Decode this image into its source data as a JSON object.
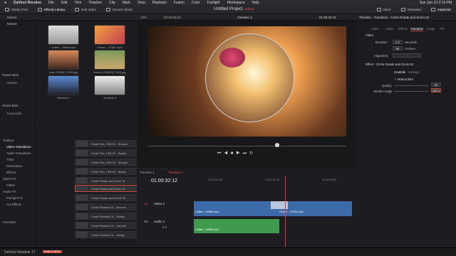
{
  "mac": {
    "app": "DaVinci Resolve",
    "menus": [
      "File",
      "Edit",
      "Trim",
      "Timeline",
      "Clip",
      "Mark",
      "View",
      "Playback",
      "Fusion",
      "Color",
      "Fairlight",
      "Workspace",
      "Help"
    ],
    "datetime": "Sun Jan 10  2:19 PM"
  },
  "toolbar": {
    "media_pool": "Media Pool",
    "effects_library": "Effects Library",
    "edit_index": "Edit Index",
    "sound_library": "Sound Library",
    "project_title": "Untitled Project",
    "edited": "Edited",
    "mixer": "Mixer",
    "metadata": "Metadata",
    "inspector": "Inspector"
  },
  "subbar": {
    "master": "Master",
    "zoom": "43%",
    "timecode_left": "00:00:59:04",
    "timeline_name": "Timeline 2",
    "timecode_right": "01:00:32:12",
    "inspector_title": "Timeline - Transition - Circle Rotate and Zoom 02"
  },
  "media": {
    "items": [
      "Coffee - 40689.mp4",
      "Flower - 37351.mp4",
      "man-721832_1920.jpg",
      "tennis-2785305_1920.jpg",
      "Timeline 1",
      "Timeline 2"
    ]
  },
  "bins": {
    "power": "Power Bins",
    "power_master": "Master",
    "smart": "Smart Bins",
    "keywords": "Keywords"
  },
  "fxtree": {
    "toolbox": "Toolbox",
    "video_transitions": "Video Transitions",
    "audio_transitions": "Audio Transitions",
    "titles": "Titles",
    "generators": "Generators",
    "effects": "Effects",
    "open_fx": "Open FX",
    "filters": "Filters",
    "audio_fx": "Audio FX",
    "fairlight_fx": "Fairlight FX",
    "au_effects": "AU Effects",
    "favorites": "Favorites"
  },
  "fxlist": [
    "Circle Pan_T&B 02 - Bounce",
    "Circle Pan_T&B 02 - Elastic",
    "Circle Pan_T&B 02 - Smooth",
    "Circle Pan_T&B 02 - Swing",
    "Circle Rotate and Zoom 01",
    "Circle Rotate and Zoom 02",
    "Circle Rotate and Zoom 03",
    "Circle Rotation 01 - Bounce",
    "Circle Rotation 01 - Elastic",
    "Circle Rotation 01 - Smooth",
    "Circle Rotation 01 - Swing"
  ],
  "inspector": {
    "tabs": [
      "Video",
      "Audio",
      "Effects",
      "Transition",
      "Image",
      "File"
    ],
    "video": "Video",
    "duration_label": "Duration",
    "duration_val": "2.2",
    "duration_unit": "Seconds",
    "frames_val": "66",
    "frames_unit": "Frames",
    "alignment": "Alignment",
    "effect_title": "Effect - Circle Rotate and Zoom 02",
    "controls": "Controls",
    "settings": "Settings",
    "motion_blur": "Motion Blur",
    "quality": "Quality",
    "quality_val": "20",
    "shutter": "Shutter Angle",
    "shutter_val": "360.0"
  },
  "timeline": {
    "tabs": [
      "Timeline 1",
      "Timeline 2"
    ],
    "tc": "01:00:32:12",
    "ruler": [
      "01:00:24:00",
      "01:00:32:00",
      "01:00:40:00"
    ],
    "v1": "V1",
    "video1": "Video 1",
    "a1": "A1",
    "audio1": "Audio 1",
    "audio_level": "2.0",
    "clip1": "Coffee - 40689.mp4",
    "clip2": "Flower - 37351.mp4",
    "aclip": "Coffee - 40689.mp4"
  },
  "bottom": {
    "app": "DaVinci Resolve 17",
    "badge": "PUBLIC BETA"
  },
  "colors": {
    "accent": "#c94a3c",
    "clip_video": "#3d6aa8",
    "clip_audio": "#3f9a4e",
    "playhead": "#e0363c"
  }
}
